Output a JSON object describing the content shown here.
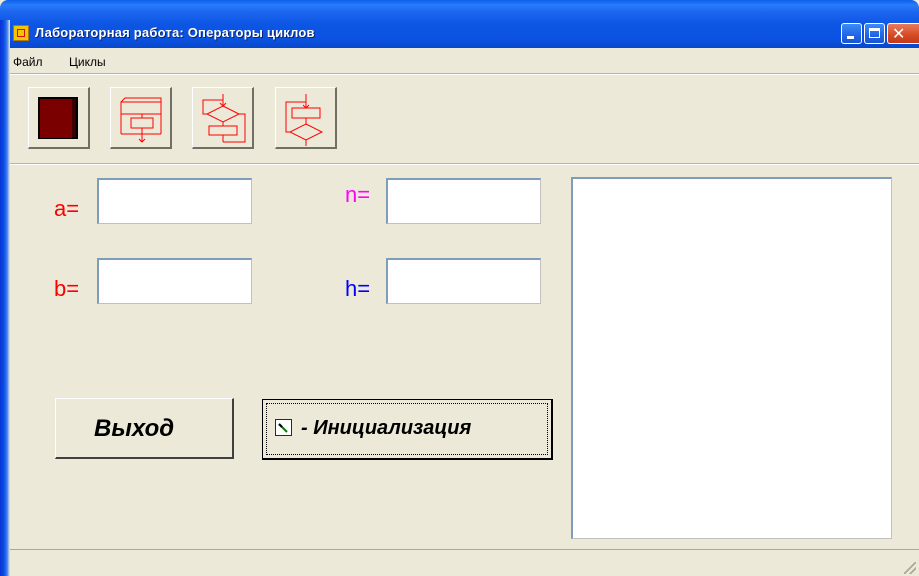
{
  "window": {
    "title": "Лабораторная работа: Операторы циклов"
  },
  "menu": {
    "items": [
      {
        "label": "Файл"
      },
      {
        "label": "Циклы"
      }
    ]
  },
  "toolbar": {
    "buttons": [
      {
        "icon": "exit-door-icon"
      },
      {
        "icon": "for-loop-flowchart-icon"
      },
      {
        "icon": "while-loop-flowchart-icon"
      },
      {
        "icon": "repeat-loop-flowchart-icon"
      }
    ]
  },
  "form": {
    "a_label": "a=",
    "b_label": "b=",
    "n_label": "n=",
    "h_label": "h=",
    "a_value": "",
    "b_value": "",
    "n_value": "",
    "h_value": ""
  },
  "buttons": {
    "exit_label": "Выход",
    "init_label": "- Инициализация"
  },
  "output": {
    "text": ""
  },
  "colors": {
    "label_a": "#ff0000",
    "label_b": "#ff0000",
    "label_n": "#ff00ff",
    "label_h": "#0000ff",
    "flowchart": "#ff0000",
    "door": "#7a0000"
  }
}
